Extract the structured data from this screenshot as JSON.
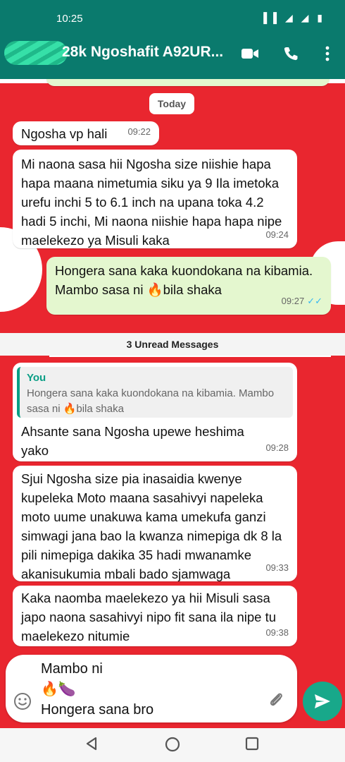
{
  "status": {
    "time": "10:25",
    "icons": "▐▐ ◢ ◢ ▮"
  },
  "header": {
    "name": "28k Ngoshafit A92UR..."
  },
  "day_label": "Today",
  "messages": [
    {
      "text": "Ngosha vp hali",
      "time": "09:22"
    },
    {
      "text": "Mi naona sasa hii Ngosha size niishie hapa hapa maana nimetumia siku  ya 9 Ila imetoka urefu inchi 5 to 6.1 inch na upana toka 4.2 hadi 5 inchi, Mi naona niishie hapa hapa nipe maelekezo ya Misuli kaka",
      "time": "09:24"
    },
    {
      "text": "Hongera sana kaka kuondokana na kibamia. Mambo sasa ni 🔥bila shaka",
      "time": "09:27"
    },
    {
      "text": "Ahsante sana Ngosha upewe heshima yako",
      "time": "09:28"
    },
    {
      "text": "Sjui Ngosha size pia inasaidia kwenye kupeleka Moto maana sasahivyi napeleka moto uume unakuwa kama umekufa ganzi simwagi jana bao la kwanza nimepiga dk 8 la pili nimepiga dakika 35  hadi mwanamke akanisukumia mbali bado sjamwaga",
      "time": "09:33"
    },
    {
      "text": "Kaka naomba maelekezo ya hii Misuli sasa japo naona sasahivyi nipo fit sana ila nipe tu maelekezo nitumie",
      "time": "09:38"
    }
  ],
  "unread_label": "3 Unread Messages",
  "quote": {
    "author": "You",
    "text": "Hongera sana kaka kuondokana na kibamia. Mambo sasa ni 🔥bila shaka"
  },
  "input": {
    "value": "Mambo ni\n🔥🍆\nHongera sana bro"
  },
  "colors": {
    "header": "#0a7a6d",
    "wallpaper": "#e9262f",
    "outgoing": "#e4f7cf",
    "send": "#18a88a"
  },
  "icons": [
    "video-call-icon",
    "phone-icon",
    "more-options-icon",
    "emoji-icon",
    "attach-icon",
    "send-icon",
    "nav-back-icon",
    "nav-home-icon",
    "nav-recents-icon"
  ]
}
